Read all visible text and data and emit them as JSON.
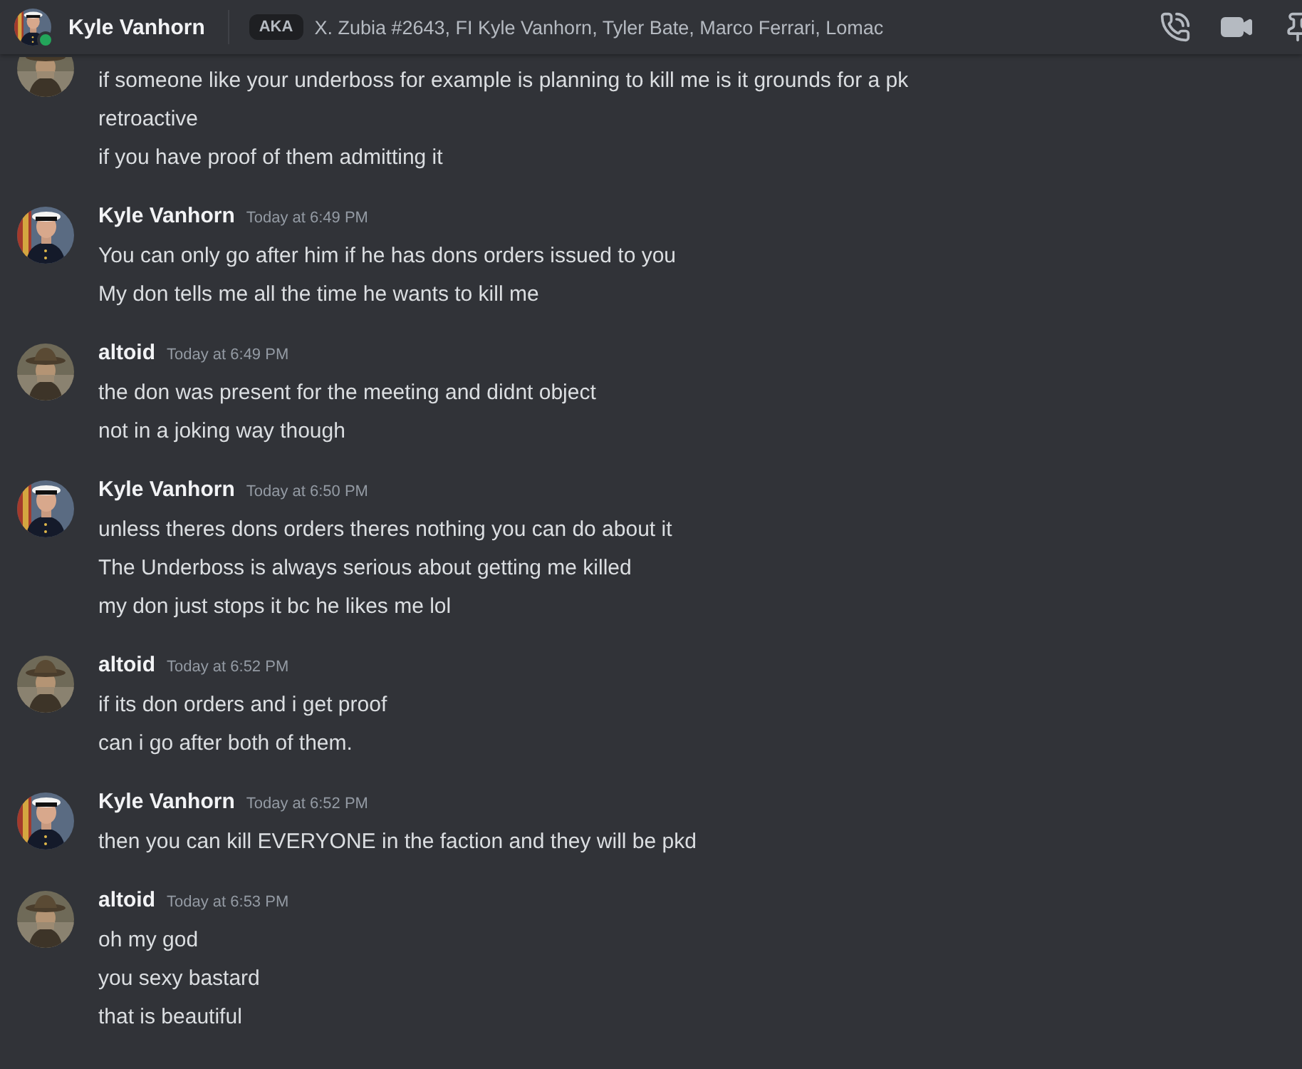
{
  "header": {
    "name": "Kyle Vanhorn",
    "online": true,
    "aka_label": "AKA",
    "aka_names": "X. Zubia #2643, FI Kyle Vanhorn, Tyler Bate, Marco Ferrari, Lomac"
  },
  "messages": [
    {
      "lines": [
        "if someone like your underboss for example is planning to kill me is it grounds for a pk",
        "retroactive",
        "if you have proof of them admitting it"
      ]
    },
    {
      "author": "Kyle Vanhorn",
      "time": "Today at 6:49 PM",
      "lines": [
        "You can only go after him if he has dons orders issued to you",
        "My don tells me all the time he wants to kill me"
      ]
    },
    {
      "author": "altoid",
      "time": "Today at 6:49 PM",
      "lines": [
        "the don was present for the meeting and didnt object",
        "not in a joking way though"
      ]
    },
    {
      "author": "Kyle Vanhorn",
      "time": "Today at 6:50 PM",
      "lines": [
        "unless theres dons orders theres nothing you can do about it",
        "The Underboss is always serious about getting me killed",
        "my don just stops it bc he likes me lol"
      ]
    },
    {
      "author": "altoid",
      "time": "Today at 6:52 PM",
      "lines": [
        "if its don orders and i get proof",
        "can i go after both of them."
      ]
    },
    {
      "author": "Kyle Vanhorn",
      "time": "Today at 6:52 PM",
      "lines": [
        "then you can kill EVERYONE in the faction and they will be pkd"
      ]
    },
    {
      "author": "altoid",
      "time": "Today at 6:53 PM",
      "lines": [
        "oh my god",
        "you sexy bastard",
        "that is beautiful"
      ]
    }
  ]
}
